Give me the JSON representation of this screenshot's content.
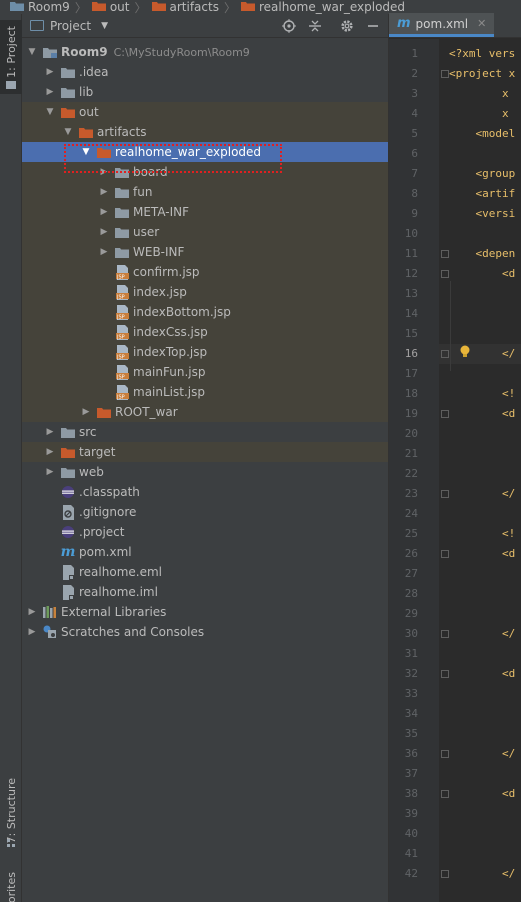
{
  "breadcrumb": [
    "Room9",
    "out",
    "artifacts",
    "realhome_war_exploded"
  ],
  "sidebar": {
    "project_tab": "1: Project",
    "structure_tab": "7: Structure",
    "favorites_tab": "Favorites"
  },
  "panel": {
    "title": "Project"
  },
  "tree": [
    {
      "label": "Room9",
      "sub": "C:\\MyStudyRoom\\Room9",
      "indent": 0,
      "arrow": "down",
      "icon": "module-folder-icon",
      "hl": false
    },
    {
      "label": ".idea",
      "indent": 1,
      "arrow": "right",
      "icon": "folder-icon",
      "hl": false
    },
    {
      "label": "lib",
      "indent": 1,
      "arrow": "right",
      "icon": "folder-icon",
      "hl": false
    },
    {
      "label": "out",
      "indent": 1,
      "arrow": "down",
      "icon": "orange-folder-icon",
      "hl": true
    },
    {
      "label": "artifacts",
      "indent": 2,
      "arrow": "down",
      "icon": "orange-folder-icon",
      "hl": true
    },
    {
      "label": "realhome_war_exploded",
      "indent": 3,
      "arrow": "down",
      "icon": "orange-folder-icon",
      "hl": false,
      "sel": true
    },
    {
      "label": "board",
      "indent": 4,
      "arrow": "right",
      "icon": "folder-icon",
      "hl": true
    },
    {
      "label": "fun",
      "indent": 4,
      "arrow": "right",
      "icon": "folder-icon",
      "hl": true
    },
    {
      "label": "META-INF",
      "indent": 4,
      "arrow": "right",
      "icon": "folder-icon",
      "hl": true
    },
    {
      "label": "user",
      "indent": 4,
      "arrow": "right",
      "icon": "folder-icon",
      "hl": true
    },
    {
      "label": "WEB-INF",
      "indent": 4,
      "arrow": "right",
      "icon": "folder-icon",
      "hl": true
    },
    {
      "label": "confirm.jsp",
      "indent": 4,
      "arrow": "none",
      "icon": "jsp-file-icon",
      "hl": true
    },
    {
      "label": "index.jsp",
      "indent": 4,
      "arrow": "none",
      "icon": "jsp-file-icon",
      "hl": true
    },
    {
      "label": "indexBottom.jsp",
      "indent": 4,
      "arrow": "none",
      "icon": "jsp-file-icon",
      "hl": true
    },
    {
      "label": "indexCss.jsp",
      "indent": 4,
      "arrow": "none",
      "icon": "jsp-file-icon",
      "hl": true
    },
    {
      "label": "indexTop.jsp",
      "indent": 4,
      "arrow": "none",
      "icon": "jsp-file-icon",
      "hl": true
    },
    {
      "label": "mainFun.jsp",
      "indent": 4,
      "arrow": "none",
      "icon": "jsp-file-icon",
      "hl": true
    },
    {
      "label": "mainList.jsp",
      "indent": 4,
      "arrow": "none",
      "icon": "jsp-file-icon",
      "hl": true
    },
    {
      "label": "ROOT_war",
      "indent": 3,
      "arrow": "right",
      "icon": "orange-folder-icon",
      "hl": true
    },
    {
      "label": "src",
      "indent": 1,
      "arrow": "right",
      "icon": "folder-icon",
      "hl": false
    },
    {
      "label": "target",
      "indent": 1,
      "arrow": "right",
      "icon": "orange-folder-icon",
      "hl": true
    },
    {
      "label": "web",
      "indent": 1,
      "arrow": "right",
      "icon": "folder-icon",
      "hl": false
    },
    {
      "label": ".classpath",
      "indent": 1,
      "arrow": "none",
      "icon": "eclipse-file-icon",
      "hl": false
    },
    {
      "label": ".gitignore",
      "indent": 1,
      "arrow": "none",
      "icon": "gitignore-file-icon",
      "hl": false
    },
    {
      "label": ".project",
      "indent": 1,
      "arrow": "none",
      "icon": "eclipse-file-icon",
      "hl": false
    },
    {
      "label": "pom.xml",
      "indent": 1,
      "arrow": "none",
      "icon": "maven-file-icon",
      "hl": false
    },
    {
      "label": "realhome.eml",
      "indent": 1,
      "arrow": "none",
      "icon": "file-icon",
      "hl": false
    },
    {
      "label": "realhome.iml",
      "indent": 1,
      "arrow": "none",
      "icon": "file-icon",
      "hl": false
    },
    {
      "label": "External Libraries",
      "indent": 0,
      "arrow": "right",
      "icon": "libraries-icon",
      "hl": false
    },
    {
      "label": "Scratches and Consoles",
      "indent": 0,
      "arrow": "right",
      "icon": "scratches-icon",
      "hl": false
    }
  ],
  "editor": {
    "tab_label": "pom.xml",
    "current_line": 16,
    "lines": [
      {
        "n": 1,
        "code": "<?xml vers"
      },
      {
        "n": 2,
        "code": "<project x"
      },
      {
        "n": 3,
        "code": "        x"
      },
      {
        "n": 4,
        "code": "        x"
      },
      {
        "n": 5,
        "code": "    <model"
      },
      {
        "n": 6,
        "code": ""
      },
      {
        "n": 7,
        "code": "    <group"
      },
      {
        "n": 8,
        "code": "    <artif"
      },
      {
        "n": 9,
        "code": "    <versi"
      },
      {
        "n": 10,
        "code": ""
      },
      {
        "n": 11,
        "code": "    <depen"
      },
      {
        "n": 12,
        "code": "        <d"
      },
      {
        "n": 13,
        "code": ""
      },
      {
        "n": 14,
        "code": ""
      },
      {
        "n": 15,
        "code": ""
      },
      {
        "n": 16,
        "code": "        </"
      },
      {
        "n": 17,
        "code": ""
      },
      {
        "n": 18,
        "code": "        <!"
      },
      {
        "n": 19,
        "code": "        <d"
      },
      {
        "n": 20,
        "code": ""
      },
      {
        "n": 21,
        "code": ""
      },
      {
        "n": 22,
        "code": ""
      },
      {
        "n": 23,
        "code": "        </"
      },
      {
        "n": 24,
        "code": ""
      },
      {
        "n": 25,
        "code": "        <!"
      },
      {
        "n": 26,
        "code": "        <d"
      },
      {
        "n": 27,
        "code": ""
      },
      {
        "n": 28,
        "code": ""
      },
      {
        "n": 29,
        "code": ""
      },
      {
        "n": 30,
        "code": "        </"
      },
      {
        "n": 31,
        "code": ""
      },
      {
        "n": 32,
        "code": "        <d"
      },
      {
        "n": 33,
        "code": ""
      },
      {
        "n": 34,
        "code": ""
      },
      {
        "n": 35,
        "code": ""
      },
      {
        "n": 36,
        "code": "        </"
      },
      {
        "n": 37,
        "code": ""
      },
      {
        "n": 38,
        "code": "        <d"
      },
      {
        "n": 39,
        "code": ""
      },
      {
        "n": 40,
        "code": ""
      },
      {
        "n": 41,
        "code": ""
      },
      {
        "n": 42,
        "code": "        </"
      }
    ]
  },
  "colors": {
    "selection": "#4b6eaf",
    "highlight": "#45433a",
    "orange_folder": "#c75a2c",
    "grey_folder": "#8e9aa4",
    "annotation": "#e02020"
  }
}
